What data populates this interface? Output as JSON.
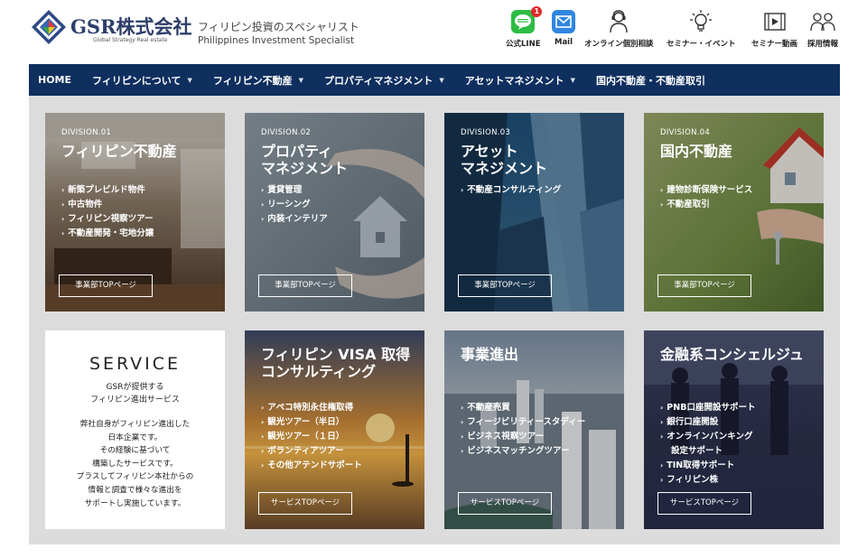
{
  "brand": {
    "name": "GSR株式会社",
    "subtitle": "Global Strategy Real estate",
    "tagline_jp": "フィリピン投資のスペシャリスト",
    "tagline_en": "Philippines Investment Specialist"
  },
  "header_nav": [
    {
      "label": "公式LINE",
      "icon": "line-icon",
      "badge": "1"
    },
    {
      "label": "Mail",
      "icon": "mail-icon"
    },
    {
      "label": "オンライン個別相談",
      "icon": "consultant-icon"
    },
    {
      "label": "セミナー・イベント",
      "icon": "lightbulb-icon"
    },
    {
      "label": "セミナー動画",
      "icon": "video-icon"
    },
    {
      "label": "採用情報",
      "icon": "people-icon"
    }
  ],
  "main_nav": [
    {
      "label": "HOME",
      "dropdown": false
    },
    {
      "label": "フィリピンについて",
      "dropdown": true
    },
    {
      "label": "フィリピン不動産",
      "dropdown": true
    },
    {
      "label": "プロパティマネジメント",
      "dropdown": true
    },
    {
      "label": "アセットマネジメント",
      "dropdown": true
    },
    {
      "label": "国内不動産・不動産取引",
      "dropdown": false
    }
  ],
  "divisions": [
    {
      "division": "DIVISION.01",
      "title": [
        "フィリピン不動産"
      ],
      "items": [
        "新築プレビルド物件",
        "中古物件",
        "フィリピン視察ツアー",
        "不動産開発・宅地分譲"
      ],
      "button": "事業部TOPページ"
    },
    {
      "division": "DIVISION.02",
      "title": [
        "プロパティ",
        "マネジメント"
      ],
      "items": [
        "賃貸管理",
        "リーシング",
        "内装インテリア"
      ],
      "button": "事業部TOPページ"
    },
    {
      "division": "DIVISION.03",
      "title": [
        "アセット",
        "マネジメント"
      ],
      "items": [
        "不動産コンサルティング"
      ],
      "button": "事業部TOPページ"
    },
    {
      "division": "DIVISION.04",
      "title": [
        "国内不動産"
      ],
      "items": [
        "建物診断保険サービス",
        "不動産取引"
      ],
      "button": "事業部TOPページ"
    }
  ],
  "service_intro": {
    "title": "SERVICE",
    "sub1": "GSRが提供する",
    "sub2": "フィリピン進出サービス",
    "body": [
      "弊社自身がフィリピン進出した",
      "日本企業です。",
      "その経験に基づいて",
      "構築したサービスです。",
      "プラスしてフィリピン本社からの",
      "情報と調査で様々な進出を",
      "サポートし実施しています。"
    ]
  },
  "services": [
    {
      "title": [
        "フィリピン VISA 取得",
        "コンサルティング"
      ],
      "items": [
        "アペコ特別永住権取得",
        "観光ツアー（半日）",
        "観光ツアー（１日）",
        "ボランティアツアー",
        "その他アテンドサポート"
      ],
      "button": "サービスTOPページ"
    },
    {
      "title": [
        "事業進出"
      ],
      "items": [
        "不動産売買",
        "フィージビリティースタディー",
        "ビジネス視察ツアー",
        "ビジネスマッチングツアー"
      ],
      "button": "サービスTOPページ"
    },
    {
      "title": [
        "金融系コンシェルジュ"
      ],
      "items": [
        "PNB口座開設サポート",
        "銀行口座開設",
        "オンラインバンキング",
        "TIN取得サポート",
        "フィリピン株"
      ],
      "item_extra": "設定サポート",
      "button": "サービスTOPページ"
    }
  ],
  "arrow_glyph": "›",
  "colors": {
    "nav_bg": "#0f2f5f",
    "brand_text": "#2d3e6a",
    "line_green": "#2dbd44",
    "mail_blue": "#2f86e0",
    "content_bg": "#dcdcdc"
  }
}
